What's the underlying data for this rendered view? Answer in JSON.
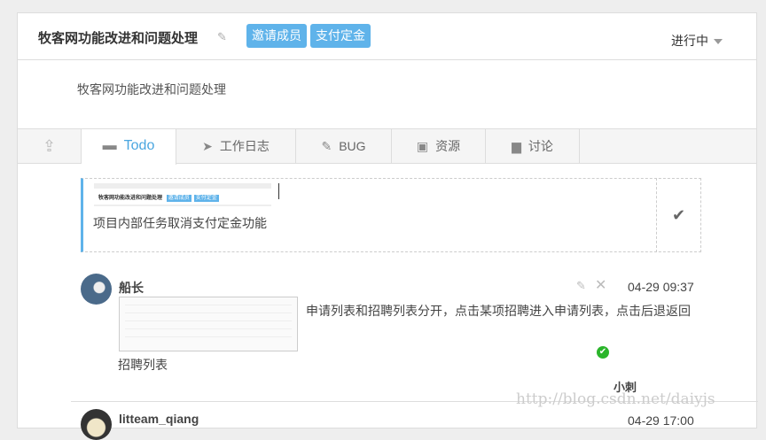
{
  "header": {
    "title": "牧客网功能改进和问题处理",
    "invite_label": "邀请成员",
    "pay_label": "支付定金",
    "status": "进行中"
  },
  "description": "牧客网功能改进和问题处理",
  "tabs": [
    {
      "label": "Todo",
      "icon": "inbox-icon"
    },
    {
      "label": "工作日志",
      "icon": "paper-plane-icon"
    },
    {
      "label": "BUG",
      "icon": "edit-icon"
    },
    {
      "label": "资源",
      "icon": "briefcase-icon"
    },
    {
      "label": "讨论",
      "icon": "comments-icon"
    }
  ],
  "todo": {
    "thumb_title": "牧客网功能改进和问题处理",
    "thumb_b1": "邀请成员",
    "thumb_b2": "支付定金",
    "text": "项目内部任务取消支付定金功能"
  },
  "comments": [
    {
      "author": "船长",
      "time": "04-29 09:37",
      "text": "申请列表和招聘列表分开，点击某项招聘进入申请列表，点击后退返回",
      "text2": "招聘列表",
      "assignee": "小刺"
    },
    {
      "author": "litteam_qiang",
      "time": "04-29 17:00"
    }
  ],
  "watermark": "http://blog.csdn.net/daiyjs"
}
